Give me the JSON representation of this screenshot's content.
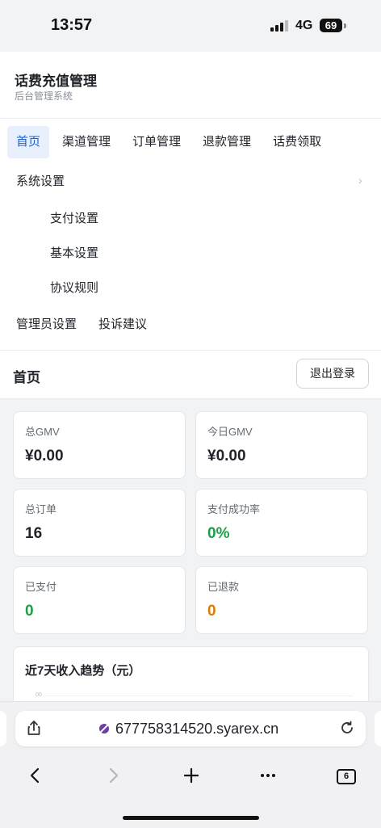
{
  "status_bar": {
    "time": "13:57",
    "network": "4G",
    "battery": "69"
  },
  "app": {
    "title": "话费充值管理",
    "subtitle": "后台管理系统"
  },
  "nav": {
    "top_items": [
      "首页",
      "渠道管理",
      "订单管理",
      "退款管理",
      "话费领取"
    ],
    "active_index": 0,
    "submenu": {
      "title": "系统设置",
      "items": [
        "支付设置",
        "基本设置",
        "协议规则"
      ]
    },
    "bottom_items": [
      "管理员设置",
      "投诉建议"
    ]
  },
  "page": {
    "title": "首页",
    "logout_label": "退出登录"
  },
  "stats": [
    {
      "label": "总GMV",
      "value": "¥0.00",
      "color": "#1f2329"
    },
    {
      "label": "今日GMV",
      "value": "¥0.00",
      "color": "#1f2329"
    },
    {
      "label": "总订单",
      "value": "16",
      "color": "#1f2329"
    },
    {
      "label": "支付成功率",
      "value": "0%",
      "color": "#1e9e47"
    },
    {
      "label": "已支付",
      "value": "0",
      "color": "#1e9e47"
    },
    {
      "label": "已退款",
      "value": "0",
      "color": "#e07b00"
    }
  ],
  "trend": {
    "title": "近7天收入趋势（元）",
    "axis_top": "00"
  },
  "browser": {
    "url": "677758314520.syarex.cn",
    "tab_count": "6"
  },
  "icons": {
    "share": "share-icon",
    "privacy": "privacy-icon",
    "reload": "reload-icon",
    "back": "back-icon",
    "forward": "forward-icon",
    "new_tab": "plus-icon",
    "more": "more-icon",
    "tabs": "tabs-icon"
  }
}
